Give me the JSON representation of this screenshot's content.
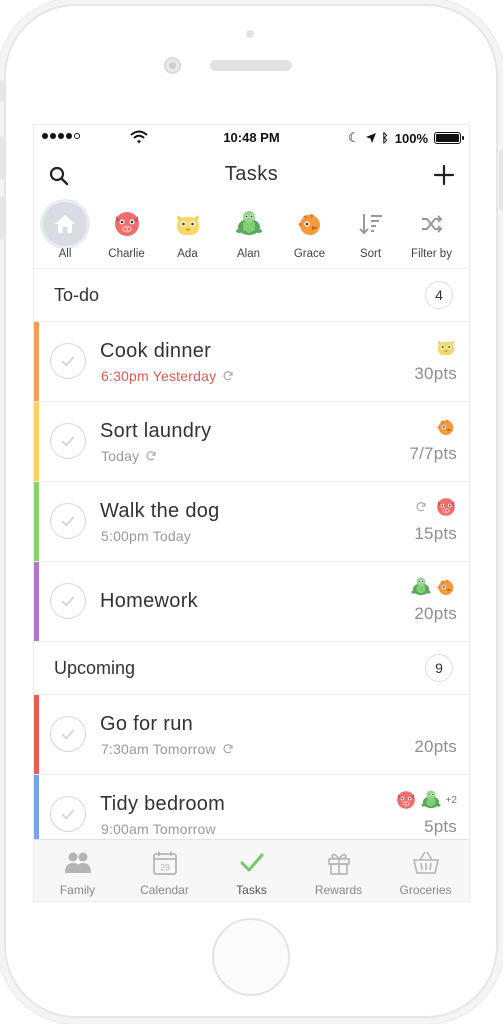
{
  "status_bar": {
    "time": "10:48 PM",
    "battery": "100%"
  },
  "header": {
    "title": "Tasks"
  },
  "filters": [
    {
      "label": "All",
      "icon": "house-icon",
      "active": true
    },
    {
      "label": "Charlie",
      "icon": "pink-pig-avatar-icon"
    },
    {
      "label": "Ada",
      "icon": "yellow-cat-avatar-icon"
    },
    {
      "label": "Alan",
      "icon": "green-turtle-avatar-icon"
    },
    {
      "label": "Grace",
      "icon": "orange-bird-avatar-icon"
    },
    {
      "label": "Sort",
      "icon": "sort-icon"
    },
    {
      "label": "Filter by",
      "icon": "shuffle-icon"
    }
  ],
  "todo": {
    "label": "To-do",
    "count": "4",
    "tasks": [
      {
        "name": "Cook dinner",
        "sub": "6:30pm Yesterday",
        "points": "30pts",
        "color": "#f0a055",
        "overdue": true
      },
      {
        "name": "Sort laundry",
        "sub": "Today",
        "points": "7/7pts",
        "color": "#f7d460"
      },
      {
        "name": "Walk the dog",
        "sub": "5:00pm Today",
        "points": "15pts",
        "color": "#8ccf6f"
      },
      {
        "name": "Homework",
        "sub": "",
        "points": "20pts",
        "color": "#b277c7"
      }
    ]
  },
  "upcoming": {
    "label": "Upcoming",
    "count": "9",
    "tasks": [
      {
        "name": "Go for run",
        "sub": "7:30am Tomorrow",
        "points": "20pts",
        "color": "#ea5a57"
      },
      {
        "name": "Tidy bedroom",
        "sub": "9:00am Tomorrow",
        "points": "5pts",
        "color": "#7aa3e3",
        "extra": "+2"
      }
    ]
  },
  "tabbar": [
    {
      "label": "Family",
      "icon": "family-icon"
    },
    {
      "label": "Calendar",
      "icon": "calendar-icon",
      "day": "29"
    },
    {
      "label": "Tasks",
      "icon": "checkmark-icon",
      "active": true
    },
    {
      "label": "Rewards",
      "icon": "gift-icon"
    },
    {
      "label": "Groceries",
      "icon": "basket-icon"
    }
  ],
  "colors": {
    "accent_green": "#7cc46f",
    "overdue_red": "#e05a4f",
    "avatar_selected": "#d9dde3"
  }
}
